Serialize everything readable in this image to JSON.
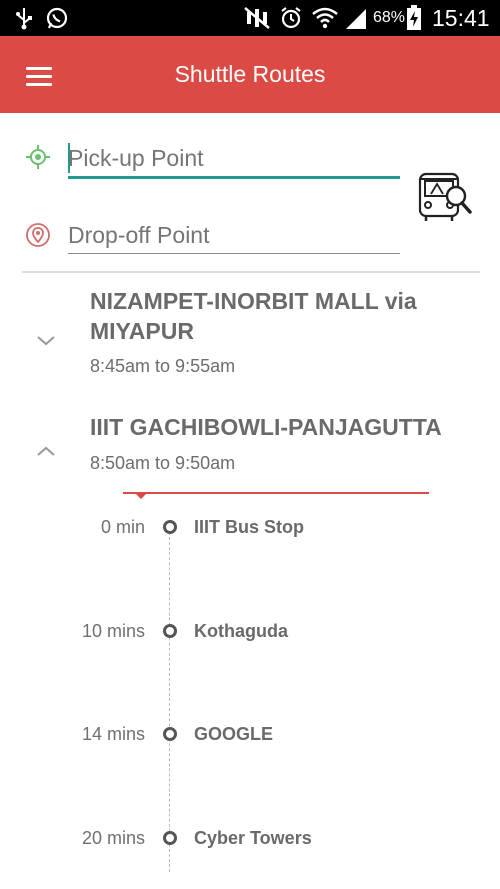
{
  "status_bar": {
    "battery": "68%",
    "time": "15:41"
  },
  "app_bar": {
    "title": "Shuttle Routes"
  },
  "search": {
    "pickup_placeholder": "Pick-up Point",
    "dropoff_placeholder": "Drop-off Point"
  },
  "routes": [
    {
      "name": "NIZAMPET-INORBIT MALL via MIYAPUR",
      "time": "8:45am to 9:55am",
      "expanded": false
    },
    {
      "name": "IIIT GACHIBOWLI-PANJAGUTTA",
      "time": "8:50am to 9:50am",
      "expanded": true,
      "stops": [
        {
          "eta": "0 min",
          "name": "IIIT Bus Stop"
        },
        {
          "eta": "10 mins",
          "name": "Kothaguda"
        },
        {
          "eta": "14 mins",
          "name": "GOOGLE"
        },
        {
          "eta": "20 mins",
          "name": "Cyber Towers"
        }
      ]
    }
  ],
  "colors": {
    "accent": "#db4a45",
    "status_bar": "#000000",
    "pickup_icon": "#6cc06c",
    "dropoff_icon": "#d06d6a",
    "input_active_line": "#1f9c8c"
  },
  "icons": {
    "usb": "usb-icon",
    "whatsapp": "whatsapp-icon",
    "mute": "mute-icon",
    "alarm": "alarm-icon",
    "wifi": "wifi-icon",
    "signal": "signal-icon",
    "battery": "battery-charging-icon",
    "menu": "menu-icon",
    "pickup": "gps-target-icon",
    "dropoff": "location-pin-icon",
    "bus_search": "bus-search-icon",
    "collapsed": "chevron-down-icon",
    "expanded": "chevron-up-icon"
  }
}
